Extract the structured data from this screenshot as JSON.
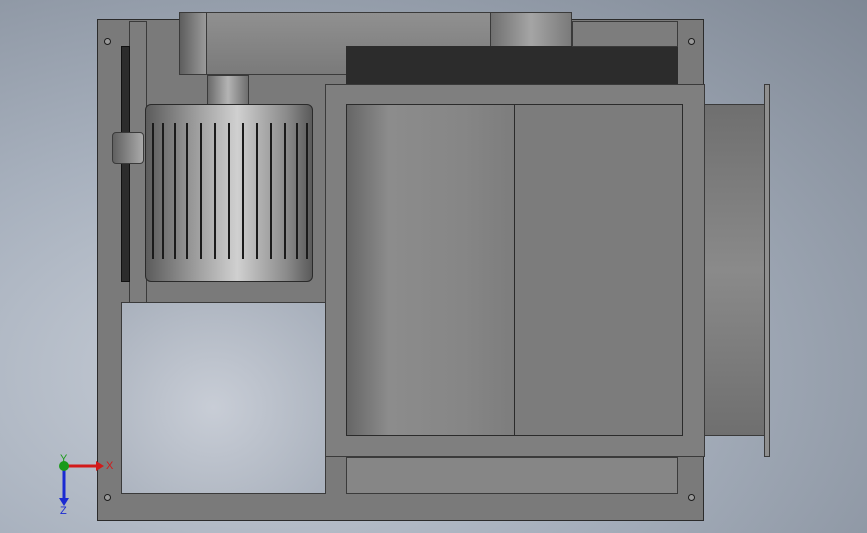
{
  "view": {
    "kind": "CAD front view of fan box / motor assembly",
    "colors": {
      "background": "#a9b2bf",
      "body": "#7a7a7a",
      "edge": "#2b2b2b"
    }
  },
  "triad": {
    "x_label": "X",
    "y_label": "Y",
    "z_label": "Z",
    "x_color": "#d21a1a",
    "y_color": "#1a9a1a",
    "z_color": "#1a2ad2"
  }
}
